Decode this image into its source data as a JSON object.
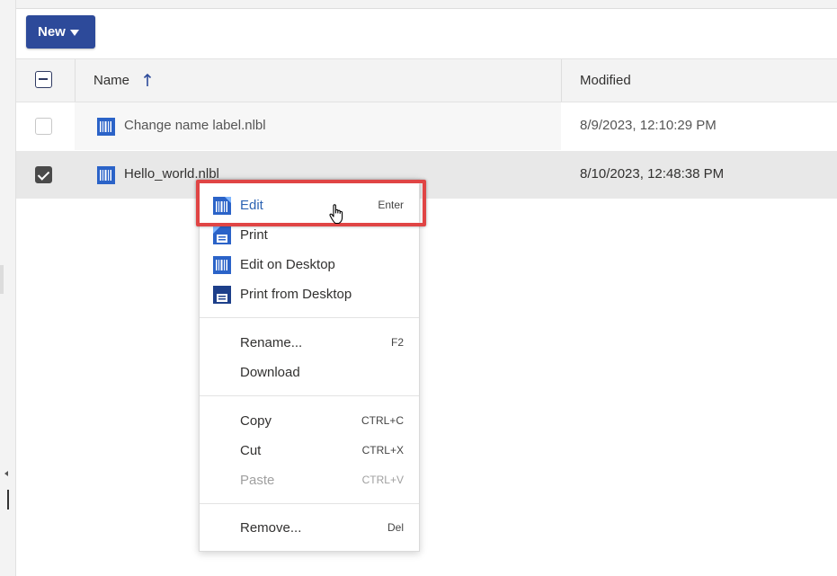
{
  "toolbar": {
    "new_label": "New"
  },
  "table": {
    "columns": {
      "name": "Name",
      "modified": "Modified"
    },
    "rows": [
      {
        "name": "Change name label.nlbl",
        "modified": "8/9/2023, 12:10:29 PM",
        "checked": false
      },
      {
        "name": "Hello_world.nlbl",
        "modified": "8/10/2023, 12:48:38 PM",
        "checked": true
      }
    ]
  },
  "context_menu": {
    "items": [
      {
        "label": "Edit",
        "shortcut": "Enter",
        "icon": "label-edit-icon"
      },
      {
        "label": "Print",
        "icon": "print-icon"
      },
      {
        "label": "Edit on Desktop",
        "icon": "label-edit-desktop-icon"
      },
      {
        "label": "Print from Desktop",
        "icon": "print-desktop-icon"
      },
      {
        "label": "Rename...",
        "shortcut": "F2"
      },
      {
        "label": "Download"
      },
      {
        "label": "Copy",
        "shortcut": "CTRL+C"
      },
      {
        "label": "Cut",
        "shortcut": "CTRL+X"
      },
      {
        "label": "Paste",
        "shortcut": "CTRL+V",
        "disabled": true
      },
      {
        "label": "Remove...",
        "shortcut": "Del"
      }
    ]
  },
  "colors": {
    "accent": "#2d4a9a",
    "highlight": "#e04545",
    "link": "#2d64b3"
  }
}
